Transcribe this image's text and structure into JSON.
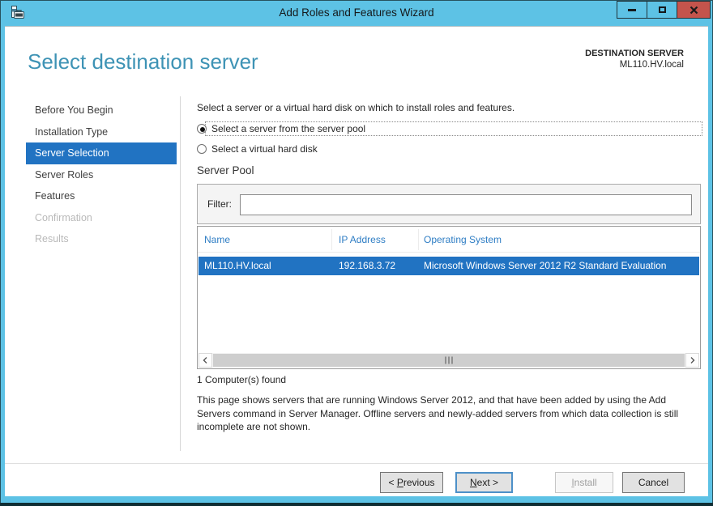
{
  "window": {
    "title": "Add Roles and Features Wizard"
  },
  "header": {
    "title": "Select destination server",
    "context_label": "DESTINATION SERVER",
    "context_value": "ML110.HV.local"
  },
  "sidebar": {
    "items": [
      {
        "label": "Before You Begin",
        "state": "default"
      },
      {
        "label": "Installation Type",
        "state": "default"
      },
      {
        "label": "Server Selection",
        "state": "selected"
      },
      {
        "label": "Server Roles",
        "state": "default"
      },
      {
        "label": "Features",
        "state": "default"
      },
      {
        "label": "Confirmation",
        "state": "disabled"
      },
      {
        "label": "Results",
        "state": "disabled"
      }
    ]
  },
  "main": {
    "intro": "Select a server or a virtual hard disk on which to install roles and features.",
    "radios": [
      {
        "label": "Select a server from the server pool",
        "selected": true
      },
      {
        "label": "Select a virtual hard disk",
        "selected": false
      }
    ],
    "server_pool": {
      "section_title": "Server Pool",
      "filter_label": "Filter:",
      "filter_value": "",
      "table": {
        "columns": [
          "Name",
          "IP Address",
          "Operating System"
        ],
        "rows": [
          {
            "name": "ML110.HV.local",
            "ip": "192.168.3.72",
            "os": "Microsoft Windows Server 2012 R2 Standard Evaluation",
            "selected": true
          }
        ]
      },
      "count_text": "1 Computer(s) found"
    },
    "description": "This page shows servers that are running Windows Server 2012, and that have been added by using the Add Servers command in Server Manager. Offline servers and newly-added servers from which data collection is still incomplete are not shown."
  },
  "footer": {
    "previous": {
      "pre": "< ",
      "key": "P",
      "rest": "revious"
    },
    "next": {
      "key": "N",
      "rest": "ext >"
    },
    "install": {
      "key": "I",
      "rest": "nstall"
    },
    "cancel_label": "Cancel"
  },
  "colors": {
    "titlebar": "#5dc2e5",
    "accent": "#2173c2",
    "heading_text": "#3e93b5",
    "close_button": "#c4544c"
  }
}
